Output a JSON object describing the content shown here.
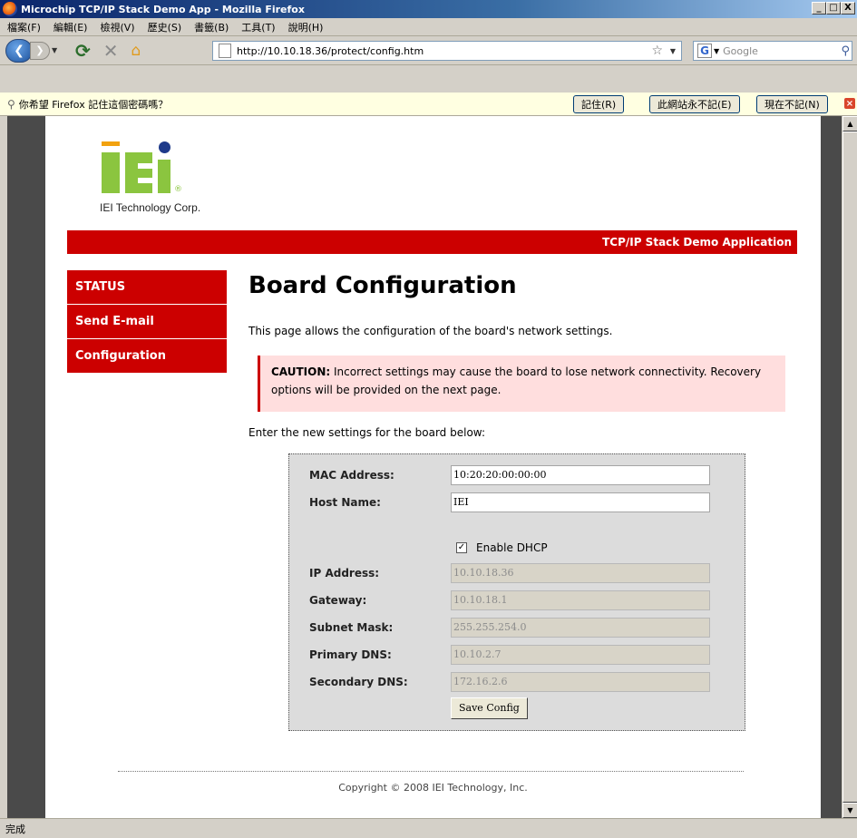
{
  "window": {
    "title": "Microchip TCP/IP Stack Demo App - Mozilla Firefox",
    "controls": [
      "_",
      "□",
      "X"
    ]
  },
  "menu": {
    "items": [
      "檔案(F)",
      "編輯(E)",
      "檢視(V)",
      "歷史(S)",
      "書籤(B)",
      "工具(T)",
      "說明(H)"
    ]
  },
  "toolbar": {
    "url": "http://10.10.18.36/protect/config.htm",
    "search_placeholder": "Google"
  },
  "notification": {
    "message": "你希望 Firefox 記住這個密碼嗎？",
    "remember": "記住(R)",
    "never": "此網站永不記(E)",
    "not_now": "現在不記(N)"
  },
  "site": {
    "logo_text": "IEI Technology Corp.",
    "banner": "TCP/IP Stack Demo Application",
    "nav": [
      "STATUS",
      "Send E-mail",
      "Configuration"
    ],
    "heading": "Board Configuration",
    "intro": "This page allows the configuration of the board's network settings.",
    "caution_label": "CAUTION:",
    "caution_text": " Incorrect settings may cause the board to lose network connectivity. Recovery options will be provided on the next page.",
    "enter_text": "Enter the new settings for the board below:",
    "copyright": "Copyright © 2008 IEI Technology, Inc."
  },
  "form": {
    "mac_label": "MAC Address:",
    "mac_value": "10:20:20:00:00:00",
    "host_label": "Host Name:",
    "host_value": "IEI",
    "dhcp_label": "Enable DHCP",
    "dhcp_checked": true,
    "ip_label": "IP Address:",
    "ip_value": "10.10.18.36",
    "gw_label": "Gateway:",
    "gw_value": "10.10.18.1",
    "mask_label": "Subnet Mask:",
    "mask_value": "255.255.254.0",
    "dns1_label": "Primary DNS:",
    "dns1_value": "10.10.2.7",
    "dns2_label": "Secondary DNS:",
    "dns2_value": "172.16.2.6",
    "save_label": "Save Config"
  },
  "status": {
    "text": "完成"
  }
}
